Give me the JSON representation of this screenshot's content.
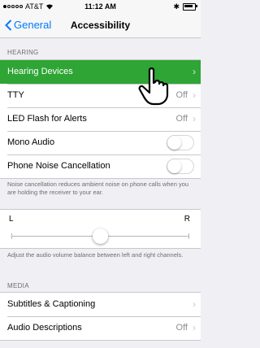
{
  "status_bar": {
    "carrier": "AT&T",
    "time": "11:12 AM",
    "signal_bars": 1,
    "wifi_icon": "wifi-icon",
    "bluetooth_icon": "bluetooth-icon",
    "battery_icon": "battery-icon"
  },
  "nav": {
    "back_label": "General",
    "title": "Accessibility"
  },
  "hearing": {
    "header": "HEARING",
    "rows": [
      {
        "label": "Hearing Devices",
        "highlighted": true
      },
      {
        "label": "TTY",
        "value": "Off"
      },
      {
        "label": "LED Flash for Alerts",
        "value": "Off"
      },
      {
        "label": "Mono Audio",
        "toggle": false
      },
      {
        "label": "Phone Noise Cancellation",
        "toggle": false
      }
    ],
    "note": "Noise cancellation reduces ambient noise on phone calls when you are holding the receiver to your ear."
  },
  "balance": {
    "left_label": "L",
    "right_label": "R",
    "value": 0.5,
    "note": "Adjust the audio volume balance between left and right channels."
  },
  "media": {
    "header": "MEDIA",
    "rows": [
      {
        "label": "Subtitles & Captioning"
      },
      {
        "label": "Audio Descriptions",
        "value": "Off"
      }
    ]
  },
  "colors": {
    "accent": "#007aff",
    "highlight": "#2ea534"
  },
  "cursor_icon": "hand-pointer-icon"
}
